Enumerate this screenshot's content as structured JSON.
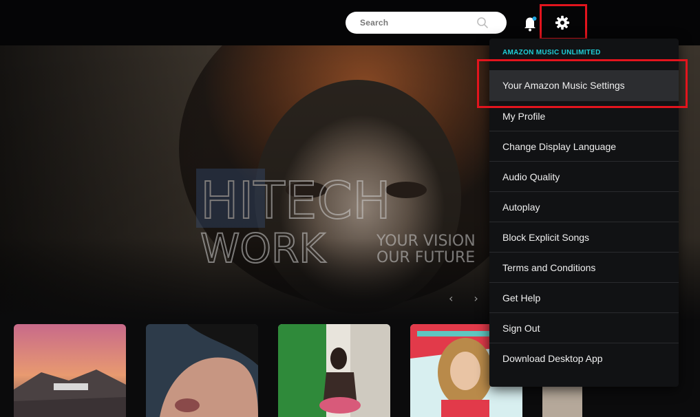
{
  "search": {
    "placeholder": "Search"
  },
  "icons": {
    "search": "magnifier-icon",
    "notifications": "bell-icon",
    "settings": "gear-icon"
  },
  "colors": {
    "highlight": "#e3141d",
    "section_label": "#1fcfd8",
    "notification_dot": "#1fa5e0"
  },
  "settings_menu": {
    "section_label": "AMAZON MUSIC UNLIMITED",
    "items": [
      {
        "label": "Your Amazon Music Settings"
      },
      {
        "label": "My Profile"
      },
      {
        "label": "Change Display Language"
      },
      {
        "label": "Audio Quality"
      },
      {
        "label": "Autoplay"
      },
      {
        "label": "Block Explicit Songs"
      },
      {
        "label": "Terms and Conditions"
      },
      {
        "label": "Get Help"
      },
      {
        "label": "Sign Out"
      },
      {
        "label": "Download Desktop App"
      }
    ]
  },
  "carousel": {
    "prev": "‹",
    "next": "›"
  },
  "watermark": {
    "line1": "HITECH",
    "line2": "WORK",
    "tag1": "YOUR VISION",
    "tag2": "OUR FUTURE"
  }
}
